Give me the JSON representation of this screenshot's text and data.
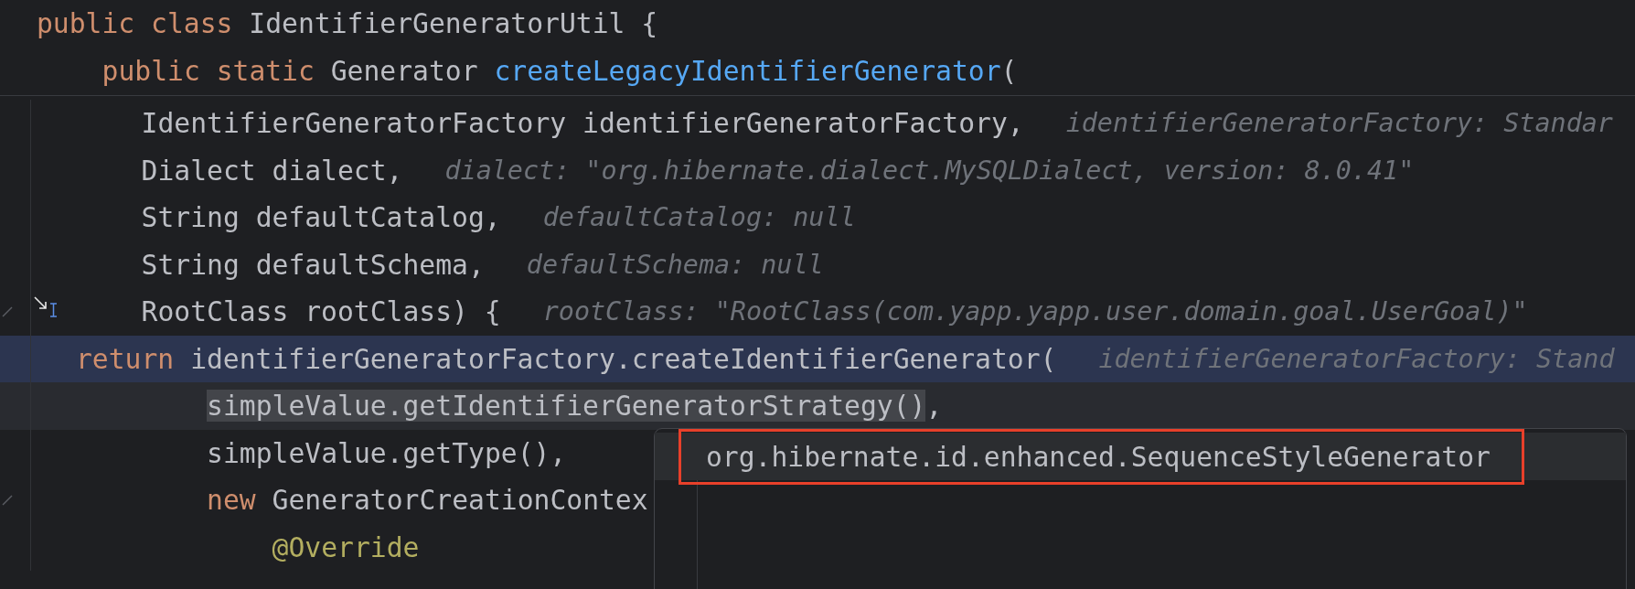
{
  "header_lines": [
    {
      "kind": "class",
      "tokens": [
        {
          "kind": "keyword",
          "text": "public class "
        },
        {
          "kind": "plain",
          "text": "IdentifierGeneratorUtil {"
        }
      ]
    },
    {
      "kind": "member",
      "tokens": [
        {
          "kind": "keyword",
          "text": "public static "
        },
        {
          "kind": "plain",
          "text": "Generator "
        },
        {
          "kind": "method",
          "text": "createLegacyIdentifierGenerator"
        },
        {
          "kind": "plain",
          "text": "("
        }
      ]
    }
  ],
  "lines": [
    {
      "kind": "parameter",
      "current": false,
      "highlighted": false,
      "gutter_mark": false,
      "mouse_cursor": false,
      "tokens": [
        {
          "kind": "plain",
          "text": "IdentifierGeneratorFactory identifierGeneratorFactory,"
        }
      ],
      "hint": "identifierGeneratorFactory: Standar"
    },
    {
      "kind": "parameter",
      "current": false,
      "highlighted": false,
      "gutter_mark": false,
      "mouse_cursor": false,
      "tokens": [
        {
          "kind": "plain",
          "text": "Dialect dialect,"
        }
      ],
      "hint": "dialect: \"org.hibernate.dialect.MySQLDialect, version: 8.0.41\""
    },
    {
      "kind": "parameter",
      "current": false,
      "highlighted": false,
      "gutter_mark": false,
      "mouse_cursor": false,
      "tokens": [
        {
          "kind": "plain",
          "text": "String defaultCatalog,"
        }
      ],
      "hint": "defaultCatalog: null"
    },
    {
      "kind": "parameter",
      "current": false,
      "highlighted": false,
      "gutter_mark": false,
      "mouse_cursor": false,
      "tokens": [
        {
          "kind": "plain",
          "text": "String defaultSchema,"
        }
      ],
      "hint": "defaultSchema: null"
    },
    {
      "kind": "parameter",
      "current": false,
      "highlighted": false,
      "gutter_mark": true,
      "mouse_cursor": true,
      "tokens": [
        {
          "kind": "plain",
          "text": "RootClass rootClass) {"
        }
      ],
      "hint": "rootClass: \"RootClass(com.yapp.yapp.user.domain.goal.UserGoal)\""
    },
    {
      "kind": "statement",
      "current": true,
      "highlighted": false,
      "gutter_mark": false,
      "mouse_cursor": false,
      "tokens": [
        {
          "kind": "keyword",
          "text": "return "
        },
        {
          "kind": "plain",
          "text": "identifierGeneratorFactory.createIdentifierGenerator("
        }
      ],
      "hint": "identifierGeneratorFactory: Stand"
    },
    {
      "kind": "argument",
      "current": false,
      "highlighted": true,
      "gutter_mark": false,
      "mouse_cursor": false,
      "tokens": [
        {
          "kind": "selection",
          "text": "simpleValue.getIdentifierGeneratorStrategy()"
        },
        {
          "kind": "plain",
          "text": ","
        }
      ]
    },
    {
      "kind": "argument",
      "current": false,
      "highlighted": false,
      "gutter_mark": false,
      "mouse_cursor": false,
      "tokens": [
        {
          "kind": "plain",
          "text": "simpleValue.getType(),"
        }
      ]
    },
    {
      "kind": "argument",
      "current": false,
      "highlighted": false,
      "gutter_mark": true,
      "mouse_cursor": false,
      "tokens": [
        {
          "kind": "keyword",
          "text": "new "
        },
        {
          "kind": "plain",
          "text": "GeneratorCreationContex"
        }
      ]
    },
    {
      "kind": "nested",
      "current": false,
      "highlighted": false,
      "gutter_mark": false,
      "mouse_cursor": false,
      "tokens": [
        {
          "kind": "annotation",
          "text": "@Override"
        }
      ]
    }
  ],
  "popup": {
    "items": [
      {
        "text": "org.hibernate.id.enhanced.SequenceStyleGenerator",
        "selected": true,
        "outlined": true
      }
    ]
  }
}
